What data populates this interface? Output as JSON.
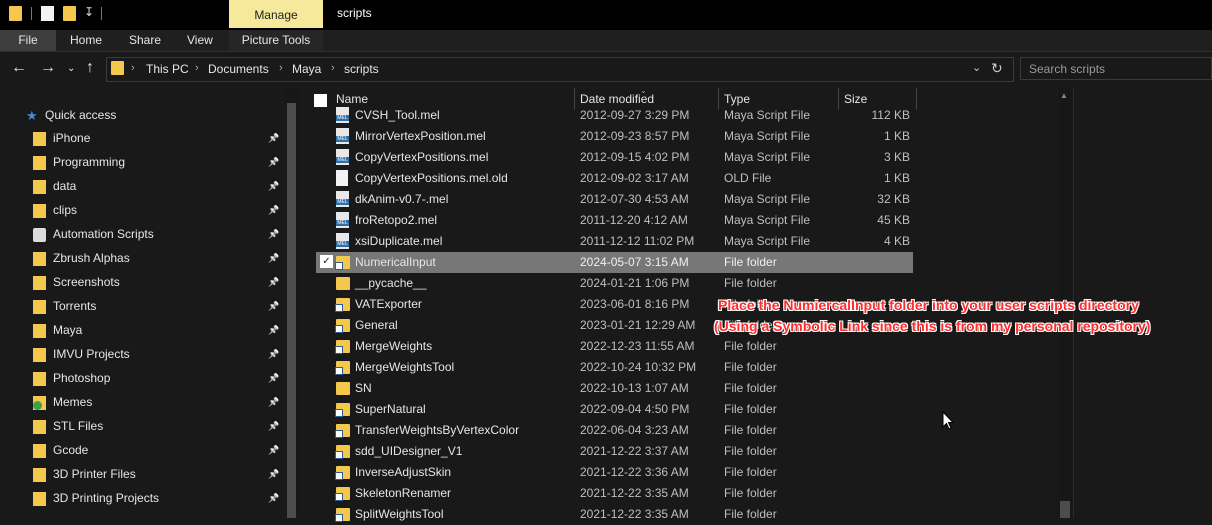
{
  "window": {
    "title": "scripts",
    "manage_tab": "Manage"
  },
  "ribbon": {
    "tabs": [
      "File",
      "Home",
      "Share",
      "View"
    ],
    "context_tab": "Picture Tools"
  },
  "address": {
    "crumbs": [
      "This PC",
      "Documents",
      "Maya",
      "scripts"
    ]
  },
  "search": {
    "placeholder": "Search scripts"
  },
  "sidebar": {
    "header": "Quick access",
    "items": [
      {
        "label": "iPhone",
        "icon": "folder-icon"
      },
      {
        "label": "Programming",
        "icon": "folder-icon"
      },
      {
        "label": "data",
        "icon": "folder-icon"
      },
      {
        "label": "clips",
        "icon": "folder-icon"
      },
      {
        "label": "Automation Scripts",
        "icon": "robot-folder-icon"
      },
      {
        "label": "Zbrush Alphas",
        "icon": "folder-icon"
      },
      {
        "label": "Screenshots",
        "icon": "folder-icon"
      },
      {
        "label": "Torrents",
        "icon": "folder-icon"
      },
      {
        "label": "Maya",
        "icon": "folder-icon"
      },
      {
        "label": "IMVU Projects",
        "icon": "folder-icon"
      },
      {
        "label": "Photoshop",
        "icon": "folder-icon"
      },
      {
        "label": "Memes",
        "icon": "synced-folder-icon"
      },
      {
        "label": "STL Files",
        "icon": "folder-icon"
      },
      {
        "label": "Gcode",
        "icon": "folder-icon"
      },
      {
        "label": "3D Printer Files",
        "icon": "folder-icon"
      },
      {
        "label": "3D Printing Projects",
        "icon": "folder-icon"
      }
    ]
  },
  "columns": {
    "name": "Name",
    "date": "Date modified",
    "type": "Type",
    "size": "Size"
  },
  "files": [
    {
      "name": "CVSH_Tool.mel",
      "date": "2012-09-27 3:29 PM",
      "type": "Maya Script File",
      "size": "112 KB",
      "icon": "mel"
    },
    {
      "name": "MirrorVertexPosition.mel",
      "date": "2012-09-23 8:57 PM",
      "type": "Maya Script File",
      "size": "1 KB",
      "icon": "mel"
    },
    {
      "name": "CopyVertexPositions.mel",
      "date": "2012-09-15 4:02 PM",
      "type": "Maya Script File",
      "size": "3 KB",
      "icon": "mel"
    },
    {
      "name": "CopyVertexPositions.mel.old",
      "date": "2012-09-02 3:17 AM",
      "type": "OLD File",
      "size": "1 KB",
      "icon": "doc"
    },
    {
      "name": "dkAnim-v0.7-.mel",
      "date": "2012-07-30 4:53 AM",
      "type": "Maya Script File",
      "size": "32 KB",
      "icon": "mel"
    },
    {
      "name": "froRetopo2.mel",
      "date": "2011-12-20 4:12 AM",
      "type": "Maya Script File",
      "size": "45 KB",
      "icon": "mel"
    },
    {
      "name": "xsiDuplicate.mel",
      "date": "2011-12-12 11:02 PM",
      "type": "Maya Script File",
      "size": "4 KB",
      "icon": "mel"
    },
    {
      "name": "NumericalInput",
      "date": "2024-05-07 3:15 AM",
      "type": "File folder",
      "size": "",
      "icon": "link-folder",
      "selected": true
    },
    {
      "name": "__pycache__",
      "date": "2024-01-21 1:06 PM",
      "type": "File folder",
      "size": "",
      "icon": "folder"
    },
    {
      "name": "VATExporter",
      "date": "2023-06-01 8:16 PM",
      "type": "File folder",
      "size": "",
      "icon": "link-folder"
    },
    {
      "name": "General",
      "date": "2023-01-21 12:29 AM",
      "type": "File folder",
      "size": "",
      "icon": "link-folder"
    },
    {
      "name": "MergeWeights",
      "date": "2022-12-23 11:55 AM",
      "type": "File folder",
      "size": "",
      "icon": "link-folder"
    },
    {
      "name": "MergeWeightsTool",
      "date": "2022-10-24 10:32 PM",
      "type": "File folder",
      "size": "",
      "icon": "link-folder"
    },
    {
      "name": "SN",
      "date": "2022-10-13 1:07 AM",
      "type": "File folder",
      "size": "",
      "icon": "folder"
    },
    {
      "name": "SuperNatural",
      "date": "2022-09-04 4:50 PM",
      "type": "File folder",
      "size": "",
      "icon": "link-folder"
    },
    {
      "name": "TransferWeightsByVertexColor",
      "date": "2022-06-04 3:23 AM",
      "type": "File folder",
      "size": "",
      "icon": "link-folder"
    },
    {
      "name": "sdd_UIDesigner_V1",
      "date": "2021-12-22 3:37 AM",
      "type": "File folder",
      "size": "",
      "icon": "link-folder"
    },
    {
      "name": "InverseAdjustSkin",
      "date": "2021-12-22 3:36 AM",
      "type": "File folder",
      "size": "",
      "icon": "link-folder"
    },
    {
      "name": "SkeletonRenamer",
      "date": "2021-12-22 3:35 AM",
      "type": "File folder",
      "size": "",
      "icon": "link-folder"
    },
    {
      "name": "SplitWeightsTool",
      "date": "2021-12-22 3:35 AM",
      "type": "File folder",
      "size": "",
      "icon": "link-folder"
    }
  ],
  "annotation": {
    "line1": "Place the NumiercalInput folder into your user scripts directory",
    "line2": "(Using a Symbolic Link since this is from my personal repository)"
  },
  "colors": {
    "accent": "#f6e99b",
    "annotation": "#ff2d2d",
    "selection": "#777777"
  }
}
